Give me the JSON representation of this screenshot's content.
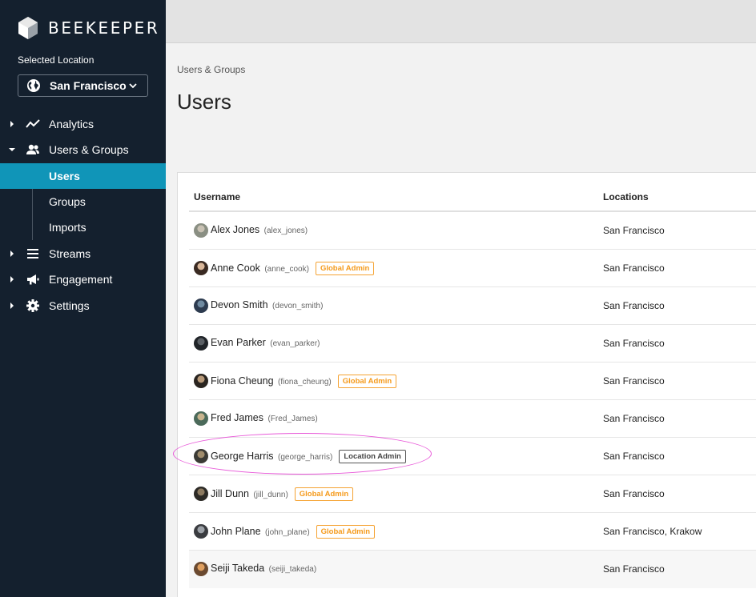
{
  "brand": {
    "name": "BEEKEEPER",
    "logo_icon": "beekeeper-cube-logo"
  },
  "sidebar": {
    "selected_location_label": "Selected Location",
    "selected_location": "San Francisco",
    "nav": [
      {
        "label": "Analytics",
        "icon": "analytics-icon",
        "expanded": false
      },
      {
        "label": "Users & Groups",
        "icon": "users-icon",
        "expanded": true
      },
      {
        "label": "Streams",
        "icon": "streams-icon",
        "expanded": false
      },
      {
        "label": "Engagement",
        "icon": "megaphone-icon",
        "expanded": false
      },
      {
        "label": "Settings",
        "icon": "gear-icon",
        "expanded": false
      }
    ],
    "sub_items": [
      {
        "label": "Users",
        "active": true
      },
      {
        "label": "Groups",
        "active": false
      },
      {
        "label": "Imports",
        "active": false
      }
    ]
  },
  "main": {
    "breadcrumb": "Users & Groups",
    "title": "Users",
    "table": {
      "columns": [
        "Username",
        "Locations"
      ],
      "rows": [
        {
          "name": "Alex Jones",
          "handle": "(alex_jones)",
          "badge": "",
          "badge_type": "",
          "location": "San Francisco"
        },
        {
          "name": "Anne Cook",
          "handle": "(anne_cook)",
          "badge": "Global Admin",
          "badge_type": "global",
          "location": "San Francisco"
        },
        {
          "name": "Devon Smith",
          "handle": "(devon_smith)",
          "badge": "",
          "badge_type": "",
          "location": "San Francisco"
        },
        {
          "name": "Evan Parker",
          "handle": "(evan_parker)",
          "badge": "",
          "badge_type": "",
          "location": "San Francisco"
        },
        {
          "name": "Fiona Cheung",
          "handle": "(fiona_cheung)",
          "badge": "Global Admin",
          "badge_type": "global",
          "location": "San Francisco"
        },
        {
          "name": "Fred James",
          "handle": "(Fred_James)",
          "badge": "",
          "badge_type": "",
          "location": "San Francisco"
        },
        {
          "name": "George Harris",
          "handle": "(george_harris)",
          "badge": "Location Admin",
          "badge_type": "location",
          "location": "San Francisco"
        },
        {
          "name": "Jill Dunn",
          "handle": "(jill_dunn)",
          "badge": "Global Admin",
          "badge_type": "global",
          "location": "San Francisco"
        },
        {
          "name": "John Plane",
          "handle": "(john_plane)",
          "badge": "Global Admin",
          "badge_type": "global",
          "location": "San Francisco, Krakow"
        },
        {
          "name": "Seiji Takeda",
          "handle": "(seiji_takeda)",
          "badge": "",
          "badge_type": "",
          "location": "San Francisco"
        }
      ]
    }
  },
  "colors": {
    "sidebar_bg": "#14202e",
    "active_item": "#1095b8",
    "global_admin_badge": "#f59a1b",
    "highlight_ellipse": "#e85ad9"
  }
}
